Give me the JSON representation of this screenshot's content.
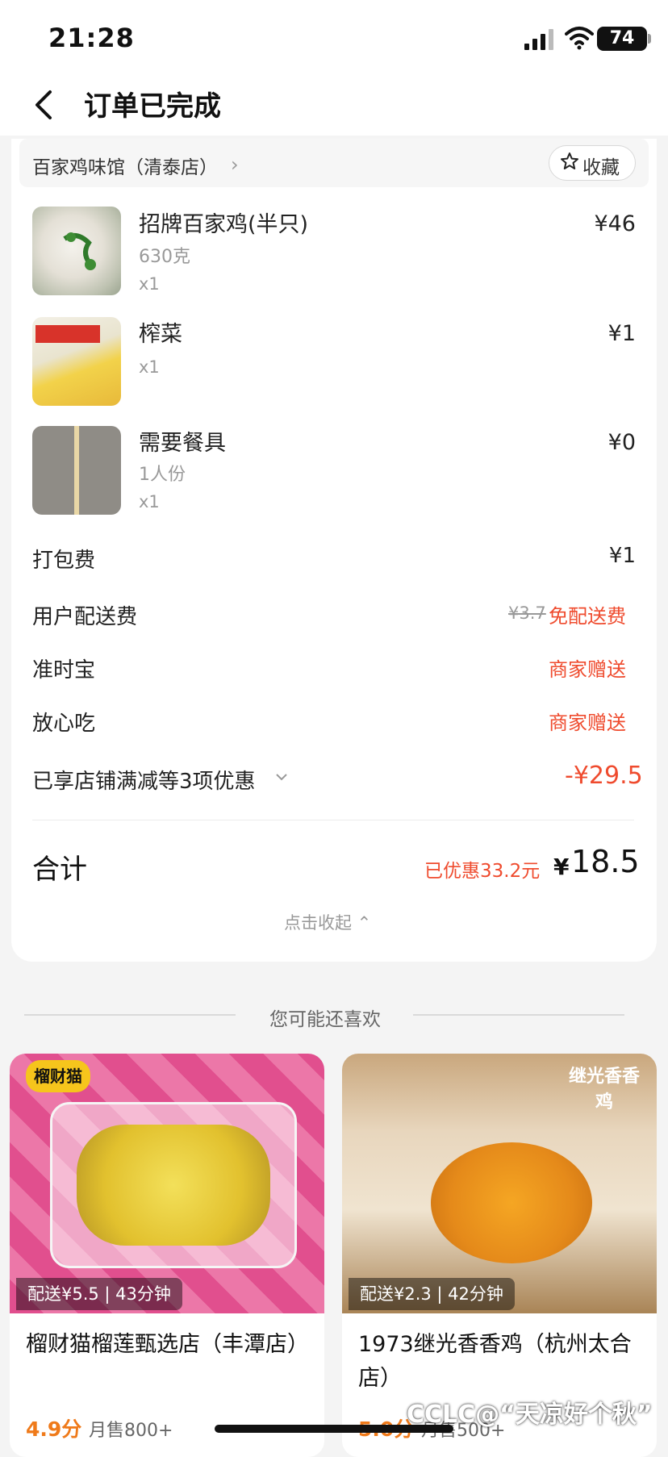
{
  "status_bar": {
    "time": "21:28",
    "battery": "74"
  },
  "nav": {
    "title": "订单已完成"
  },
  "store": {
    "name": "百家鸡味馆（清泰店）",
    "chevron": "›",
    "favorite_label": "收藏",
    "favorite_icon": "star-icon"
  },
  "items": [
    {
      "name": "招牌百家鸡(半只)",
      "spec": "630克",
      "qty": "x1",
      "price": "¥46"
    },
    {
      "name": "榨菜",
      "spec": "",
      "qty": "x1",
      "price": "¥1"
    },
    {
      "name": "需要餐具",
      "spec": "1人份",
      "qty": "x1",
      "price": "¥0"
    }
  ],
  "fees": {
    "packing": {
      "label": "打包费",
      "value": "¥1"
    },
    "delivery": {
      "label": "用户配送费",
      "original": "¥3.7",
      "value": "免配送费"
    },
    "ontime": {
      "label": "准时宝",
      "value": "商家赠送"
    },
    "safe": {
      "label": "放心吃",
      "value": "商家赠送"
    },
    "discount": {
      "label": "已享店铺满减等3项优惠",
      "value": "-¥29.5"
    }
  },
  "total": {
    "label": "合计",
    "saved": "已优惠33.2元",
    "currency": "¥",
    "amount": "18.5",
    "collapse": "点击收起 ⌃"
  },
  "recommend": {
    "title": "您可能还喜欢",
    "cards": [
      {
        "badge": "配送¥5.5 | 43分钟",
        "name": "榴财猫榴莲甄选店（丰潭店）",
        "rating": "4.9分",
        "sold": "月售800+",
        "brand": "榴财猫"
      },
      {
        "badge": "配送¥2.3 | 42分钟",
        "name": "1973继光香香鸡（杭州太合店）",
        "rating": "5.0分",
        "sold": "月售500+",
        "brand": "继光香香鸡"
      }
    ]
  },
  "watermark": "CCLC@“天凉好个秋”",
  "colors": {
    "accent": "#ef4b2e",
    "rating": "#ef7a1a"
  }
}
